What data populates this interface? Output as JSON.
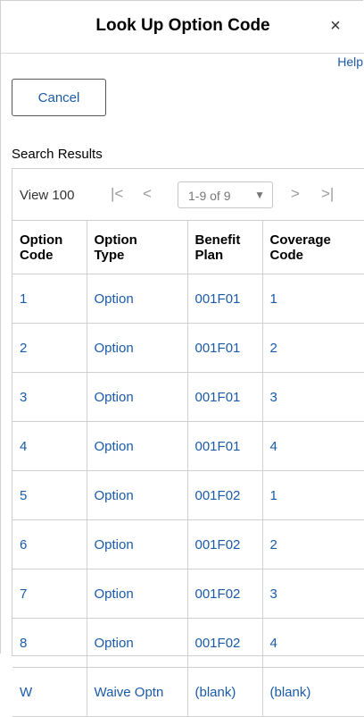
{
  "dialog": {
    "title": "Look Up Option Code",
    "close_symbol": "×",
    "help_label": "Help",
    "cancel_label": "Cancel"
  },
  "results": {
    "label": "Search Results",
    "view_label": "View 100",
    "first_icon": "first-page-icon",
    "prev_icon": "previous-page-icon",
    "next_icon": "next-page-icon",
    "last_icon": "last-page-icon",
    "range": "1-9 of 9",
    "columns": [
      [
        "Option",
        "Code"
      ],
      [
        "Option",
        "Type"
      ],
      [
        "Benefit",
        "Plan"
      ],
      [
        "Coverage",
        "Code"
      ]
    ],
    "rows": [
      [
        "1",
        "Option",
        "001F01",
        "1"
      ],
      [
        "2",
        "Option",
        "001F01",
        "2"
      ],
      [
        "3",
        "Option",
        "001F01",
        "3"
      ],
      [
        "4",
        "Option",
        "001F01",
        "4"
      ],
      [
        "5",
        "Option",
        "001F02",
        "1"
      ],
      [
        "6",
        "Option",
        "001F02",
        "2"
      ],
      [
        "7",
        "Option",
        "001F02",
        "3"
      ],
      [
        "8",
        "Option",
        "001F02",
        "4"
      ],
      [
        "W",
        "Waive Optn",
        "(blank)",
        "(blank)"
      ]
    ]
  },
  "colors": {
    "link": "#1a5aa8",
    "border": "#cfcfcf",
    "disabled": "#9a9a9a"
  }
}
